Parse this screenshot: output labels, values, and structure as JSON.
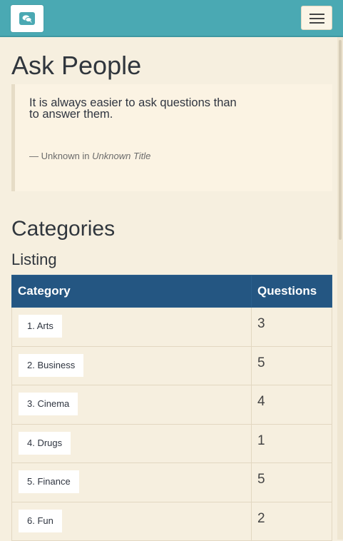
{
  "header": {
    "brand_icon": "speech-bubbles-icon",
    "menu_icon": "hamburger-menu-icon",
    "bar_color": "#4aa9b3"
  },
  "page": {
    "title": "Ask People",
    "quote": {
      "text": "It is always easier to ask questions than to answer them.",
      "author": "— Unknown in ",
      "source": "Unknown Title"
    },
    "categories_title": "Categories",
    "listing_title": "Listing"
  },
  "table": {
    "header_color": "#245682",
    "columns": [
      "Category",
      "Questions"
    ],
    "rows": [
      {
        "category": "1. Arts",
        "questions": "3"
      },
      {
        "category": "2. Business",
        "questions": "5"
      },
      {
        "category": "3. Cinema",
        "questions": "4"
      },
      {
        "category": "4. Drugs",
        "questions": "1"
      },
      {
        "category": "5. Finance",
        "questions": "5"
      },
      {
        "category": "6. Fun",
        "questions": "2"
      }
    ]
  }
}
